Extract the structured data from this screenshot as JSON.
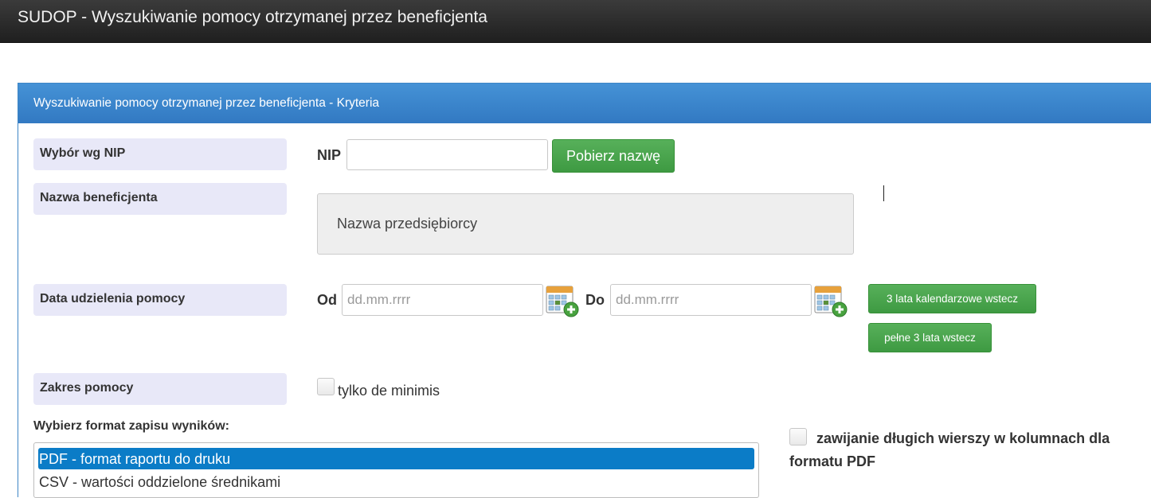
{
  "app": {
    "title": "SUDOP - Wyszukiwanie pomocy otrzymanej przez beneficjenta"
  },
  "panel": {
    "heading": "Wyszukiwanie pomocy otrzymanej przez beneficjenta - Kryteria"
  },
  "nip_section": {
    "label": "Wybór wg NIP",
    "field_label": "NIP",
    "input_value": "",
    "fetch_button": "Pobierz nazwę"
  },
  "beneficiary_section": {
    "label": "Nazwa beneficjenta",
    "name_value": "Nazwa przedsiębiorcy"
  },
  "date_section": {
    "label": "Data udzielenia pomocy",
    "from_label": "Od",
    "from_placeholder": "dd.mm.rrrr",
    "to_label": "Do",
    "to_placeholder": "dd.mm.rrrr",
    "calendar_icon": "calendar-add-icon",
    "button_calendar_years": "3 lata kalendarzowe wstecz",
    "button_full_years": "pełne 3 lata wstecz"
  },
  "scope_section": {
    "label": "Zakres pomocy",
    "de_minimis_label": "tylko de minimis",
    "de_minimis_checked": false
  },
  "format_section": {
    "label": "Wybierz format zapisu wyników:",
    "options": [
      {
        "label": "PDF - format raportu do druku",
        "selected": true
      },
      {
        "label": "CSV - wartości oddzielone średnikami",
        "selected": false
      }
    ],
    "wrap_label_line1": "zawijanie długich wierszy w kolumnach dla",
    "wrap_label_line2": "formatu PDF",
    "wrap_checked": false
  },
  "colors": {
    "header_bg": "#2b2b2b",
    "panel_blue": "#3a85cc",
    "label_bg": "#e8e8f8",
    "button_green": "#4aa54d",
    "selected_option": "#0b7cc7"
  }
}
